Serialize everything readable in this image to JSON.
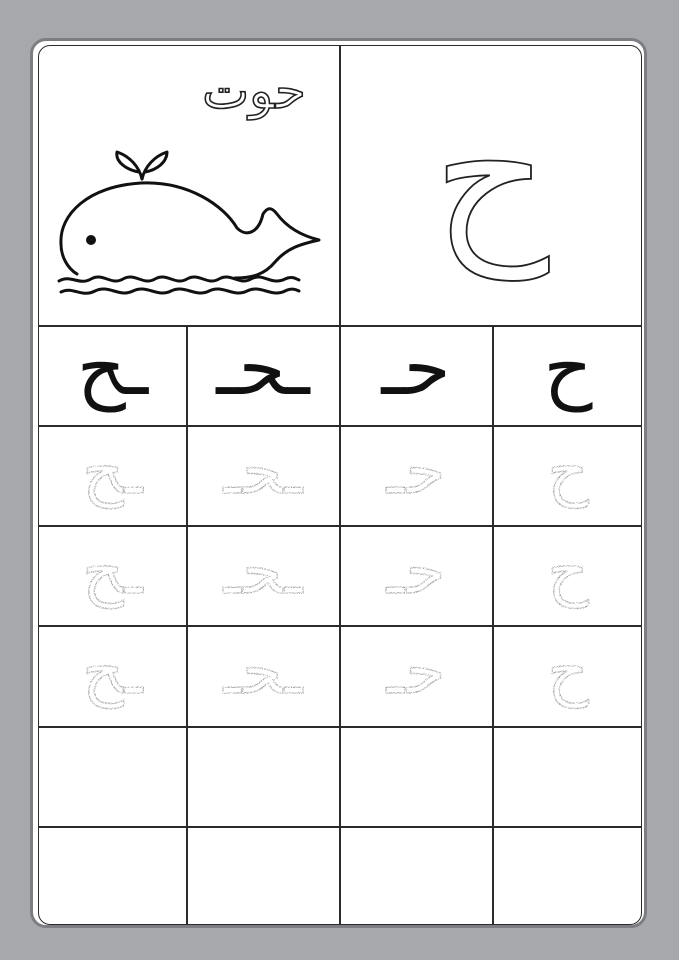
{
  "picture": {
    "word": "حوت",
    "subject": "whale"
  },
  "letter": "ح",
  "forms": {
    "isolated": "ح",
    "initial": "حـ",
    "medial": "ـحـ",
    "final": "ـح"
  },
  "practice_rows": 3,
  "blank_rows": 2
}
